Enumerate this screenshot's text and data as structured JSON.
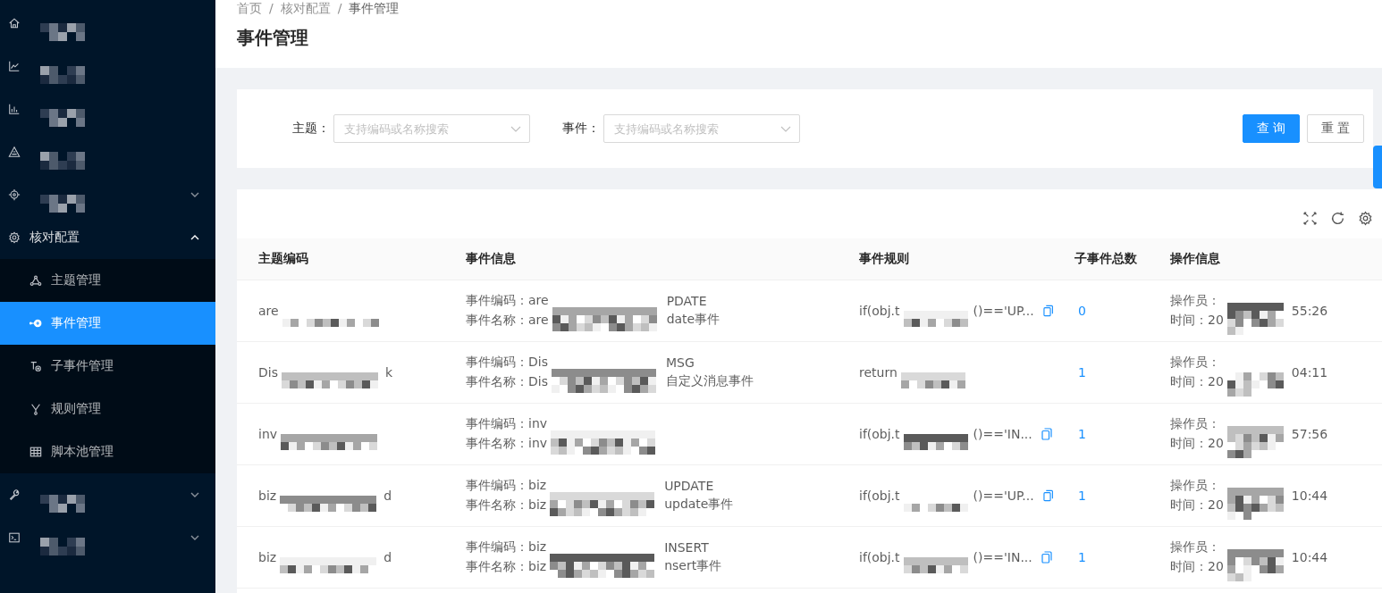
{
  "sidebar": {
    "items": [
      {
        "kind": "masked"
      },
      {
        "kind": "masked"
      },
      {
        "kind": "masked"
      },
      {
        "kind": "masked"
      },
      {
        "kind": "masked",
        "expanded": false
      },
      {
        "kind": "labeled",
        "label": "核对配置",
        "expanded": true,
        "children": [
          {
            "label": "主题管理",
            "selected": false
          },
          {
            "label": "事件管理",
            "selected": true
          },
          {
            "label": "子事件管理",
            "selected": false
          },
          {
            "label": "规则管理",
            "selected": false
          },
          {
            "label": "脚本池管理",
            "selected": false
          }
        ]
      },
      {
        "kind": "masked",
        "expanded": false
      },
      {
        "kind": "masked",
        "expanded": false
      }
    ]
  },
  "breadcrumb": {
    "separator": "/",
    "items": [
      "首页",
      "核对配置",
      "事件管理"
    ]
  },
  "page_title": "事件管理",
  "filters": [
    {
      "label": "主题：",
      "placeholder": "支持编码或名称搜索"
    },
    {
      "label": "事件：",
      "placeholder": "支持编码或名称搜索"
    }
  ],
  "buttons": [
    {
      "label": "查 询",
      "kind": "primary"
    },
    {
      "label": "重 置",
      "kind": "default"
    }
  ],
  "table": {
    "columns": [
      "主题编码",
      "事件信息",
      "事件规则",
      "子事件总数",
      "操作信息"
    ],
    "rows": [
      {
        "topic": {
          "start": "are"
        },
        "info": [
          {
            "start": "事件编码：are",
            "end": "PDATE"
          },
          {
            "start": "事件名称：are",
            "end": "date事件"
          }
        ],
        "rule": {
          "start": "if(obj.t",
          "end": "()=='UP...",
          "copyable": true
        },
        "count": "0",
        "operator": [
          {
            "start": "操作员："
          },
          {
            "start": "时间：20",
            "end": "55:26"
          }
        ]
      },
      {
        "topic": {
          "start": "Dis",
          "end": "k"
        },
        "info": [
          {
            "start": "事件编码：Dis",
            "end": "MSG"
          },
          {
            "start": "事件名称：Dis",
            "end": "自定义消息事件"
          }
        ],
        "rule": {
          "start": "return",
          "copyable": false
        },
        "count": "1",
        "operator": [
          {
            "start": "操作员："
          },
          {
            "start": "时间：20",
            "end": "04:11"
          }
        ]
      },
      {
        "topic": {
          "start": "inv"
        },
        "info": [
          {
            "start": "事件编码：inv"
          },
          {
            "start": "事件名称：inv"
          }
        ],
        "rule": {
          "start": "if(obj.t",
          "end": "()=='IN...",
          "copyable": true
        },
        "count": "1",
        "operator": [
          {
            "start": "操作员："
          },
          {
            "start": "时间：20",
            "end": "57:56"
          }
        ]
      },
      {
        "topic": {
          "start": "biz",
          "end": "d"
        },
        "info": [
          {
            "start": "事件编码：biz",
            "end": "UPDATE"
          },
          {
            "start": "事件名称：biz",
            "end": "update事件"
          }
        ],
        "rule": {
          "start": "if(obj.t",
          "end": "()=='UP...",
          "copyable": true
        },
        "count": "1",
        "operator": [
          {
            "start": "操作员："
          },
          {
            "start": "时间：20",
            "end": "10:44"
          }
        ]
      },
      {
        "topic": {
          "start": "biz",
          "end": "d"
        },
        "info": [
          {
            "start": "事件编码：biz",
            "end": "INSERT"
          },
          {
            "start": "事件名称：biz",
            "end": "nsert事件"
          }
        ],
        "rule": {
          "start": "if(obj.t",
          "end": "()=='IN...",
          "copyable": true
        },
        "count": "1",
        "operator": [
          {
            "start": "操作员："
          },
          {
            "start": "时间：20",
            "end": "10:44"
          }
        ]
      }
    ]
  }
}
